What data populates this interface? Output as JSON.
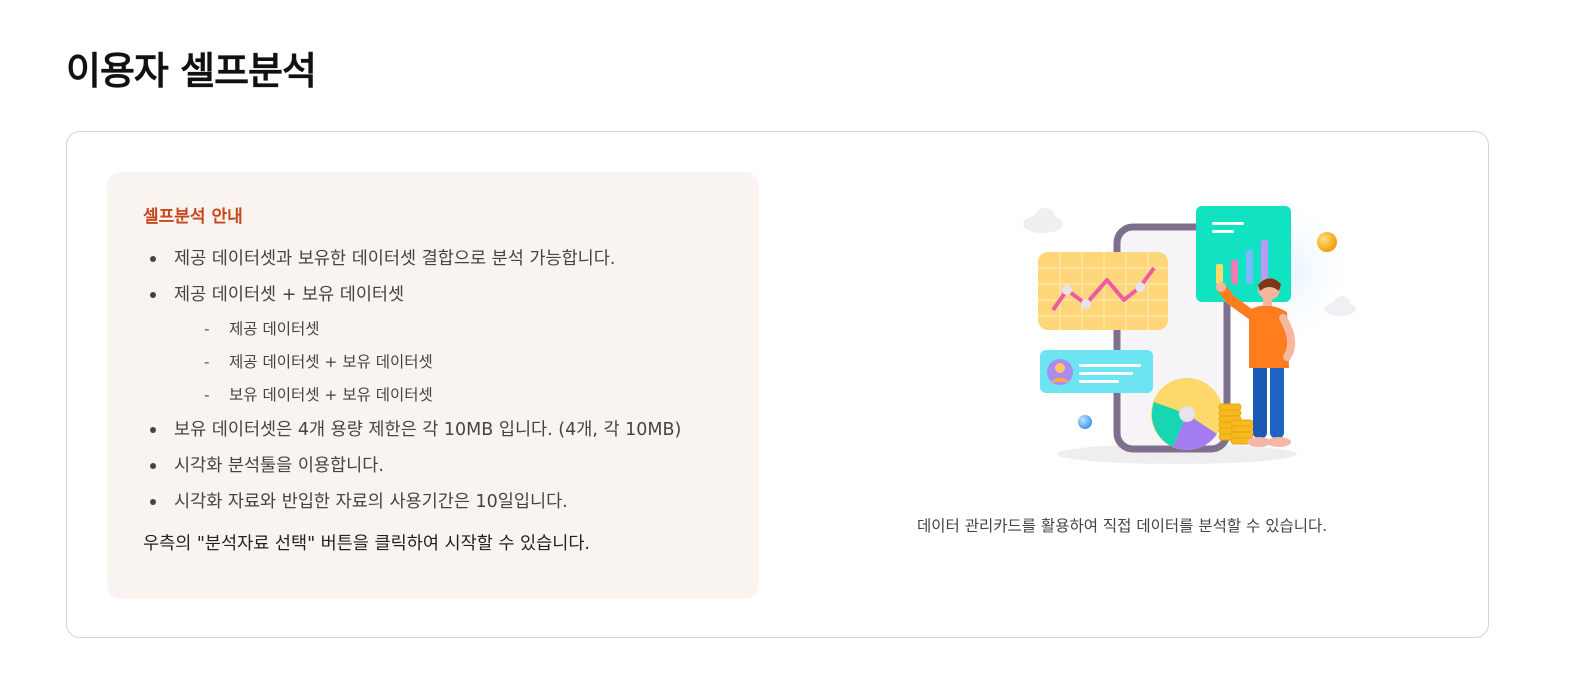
{
  "page": {
    "title": "이용자 셀프분석"
  },
  "guide": {
    "title": "셀프분석 안내",
    "items": [
      "제공 데이터셋과 보유한 데이터셋 결합으로 분석 가능합니다.",
      "제공 데이터셋 + 보유 데이터셋",
      "보유 데이터셋은 4개 용량 제한은 각 10MB 입니다. (4개, 각 10MB)",
      "시각화 분석툴을 이용합니다.",
      "시각화 자료와 반입한 자료의 사용기간은 10일입니다."
    ],
    "sub_items": [
      "제공 데이터셋",
      "제공 데이터셋 + 보유 데이터셋",
      "보유 데이터셋 + 보유 데이터셋"
    ],
    "footer": "우측의 \"분석자료 선택\" 버튼을 클릭하여 시작할 수 있습니다."
  },
  "illustration": {
    "caption": "데이터 관리카드를 활용하여 직접 데이터를 분석할 수 있습니다."
  },
  "colors": {
    "accent": "#c8461c",
    "guide_bg": "#f9f4f0",
    "border": "#d4d4d4"
  }
}
